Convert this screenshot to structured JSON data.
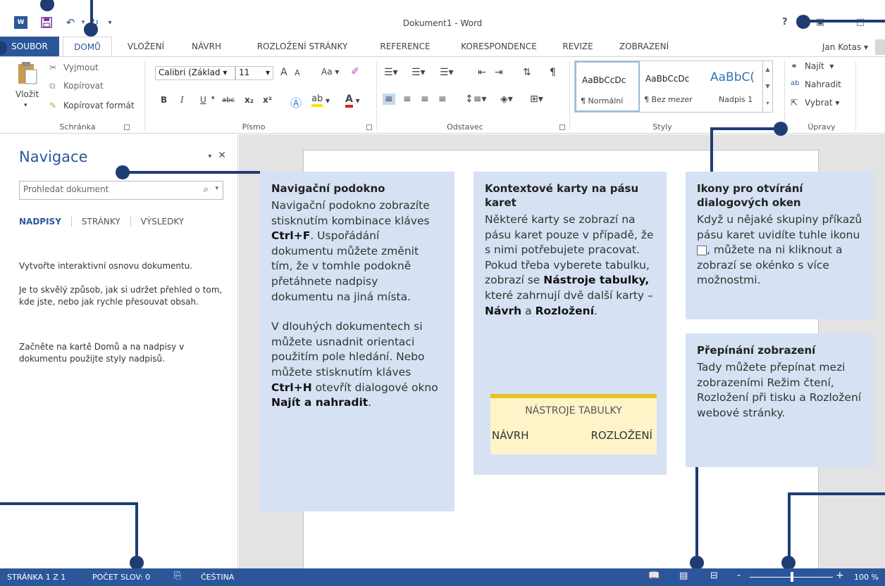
{
  "window": {
    "title": "Dokument1 - Word",
    "help": "?",
    "user": "Jan Kotas",
    "user_caret": "▾",
    "app_icon": "W"
  },
  "tabs": [
    {
      "label": "SOUBOR"
    },
    {
      "label": "DOMŮ"
    },
    {
      "label": "VLOŽENÍ"
    },
    {
      "label": "NÁVRH"
    },
    {
      "label": "ROZLOŽENÍ STRÁNKY"
    },
    {
      "label": "REFERENCE"
    },
    {
      "label": "KORESPONDENCE"
    },
    {
      "label": "REVIZE"
    },
    {
      "label": "ZOBRAZENÍ"
    }
  ],
  "ribbon": {
    "clipboard": {
      "paste": "Vložit",
      "cut": "Vyjmout",
      "copy": "Kopírovat",
      "format_painter": "Kopírovat formát",
      "label": "Schránka"
    },
    "font": {
      "name": "Calibri (Základ",
      "size": "11",
      "grow": "A",
      "shrink": "A",
      "case": "Aa",
      "bold": "B",
      "italic": "I",
      "underline": "U",
      "strike": "abc",
      "sub": "x₂",
      "sup": "x²",
      "label": "Písmo"
    },
    "paragraph": {
      "label": "Odstavec"
    },
    "styles": {
      "items": [
        {
          "sample": "AaBbCcDc",
          "name": "¶ Normální"
        },
        {
          "sample": "AaBbCcDc",
          "name": "¶ Bez mezer"
        },
        {
          "sample": "AaBbC(",
          "name": "Nadpis 1"
        }
      ],
      "label": "Styly"
    },
    "editing": {
      "find": "Najít",
      "replace": "Nahradit",
      "select": "Vybrat",
      "label": "Úpravy"
    }
  },
  "nav": {
    "title": "Navigace",
    "search_placeholder": "Prohledat dokument",
    "tabs": [
      "NADPISY",
      "STRÁNKY",
      "VÝSLEDKY"
    ],
    "text1": "Vytvořte interaktivní osnovu dokumentu.",
    "text2": "Je to skvělý způsob, jak si udržet přehled o tom, kde jste, nebo jak rychle přesouvat obsah.",
    "text3": "Začněte na kartě Domů a na nadpisy v dokumentu použijte styly nadpisů."
  },
  "callouts": {
    "nav": {
      "title": "Navigační podokno",
      "p1_a": "Navigační podokno zobrazíte stisknutím kombinace kláves ",
      "p1_b": "Ctrl+F",
      "p1_c": ". Uspořádání dokumentu můžete změnit tím, že v tomhle podokně přetáhnete nadpisy dokumentu na jiná místa.",
      "p2_a": "V dlouhých dokumentech si můžete usnadnit orientaci použitím pole hledání. Nebo můžete stisknutím kláves ",
      "p2_b": "Ctrl+H",
      "p2_c": " otevřít dialogové okno ",
      "p2_d": "Najít a nahradit",
      "p2_e": "."
    },
    "context": {
      "title": "Kontextové karty na pásu karet",
      "p_a": "Některé karty se zobrazí na pásu karet pouze v případě, že s nimi potřebujete pracovat. Pokud třeba vyberete tabulku, zobrazí se ",
      "p_b": "Nástroje tabulky,",
      "p_c": " které zahrnují dvě další karty – ",
      "p_d": "Návrh",
      "p_e": " a ",
      "p_f": "Rozložení",
      "p_g": ".",
      "tt_header": "NÁSTROJE TABULKY",
      "tt_a": "NÁVRH",
      "tt_b": "ROZLOŽENÍ"
    },
    "dialog": {
      "title": "Ikony pro otvírání dialogových oken",
      "p_a": "Když u nějaké skupiny příkazů pásu karet uvidíte tuhle ikonu ",
      "p_b": ", můžete na ni kliknout a zobrazí se okénko s více možnostmi."
    },
    "views": {
      "title": "Přepínání zobrazení",
      "p": "Tady můžete přepínat mezi zobrazeními Režim čtení, Rozložení při tisku a Rozložení webové stránky."
    }
  },
  "status": {
    "page": "STRÁNKA 1 Z 1",
    "words": "POČET SLOV: 0",
    "lang": "ČEŠTINA",
    "zoom_minus": "-",
    "zoom_plus": "+",
    "zoom": "100 %"
  },
  "colors": {
    "accent": "#2b579a",
    "callout_bg": "#d6e2f3",
    "connector": "#1f3c73"
  }
}
